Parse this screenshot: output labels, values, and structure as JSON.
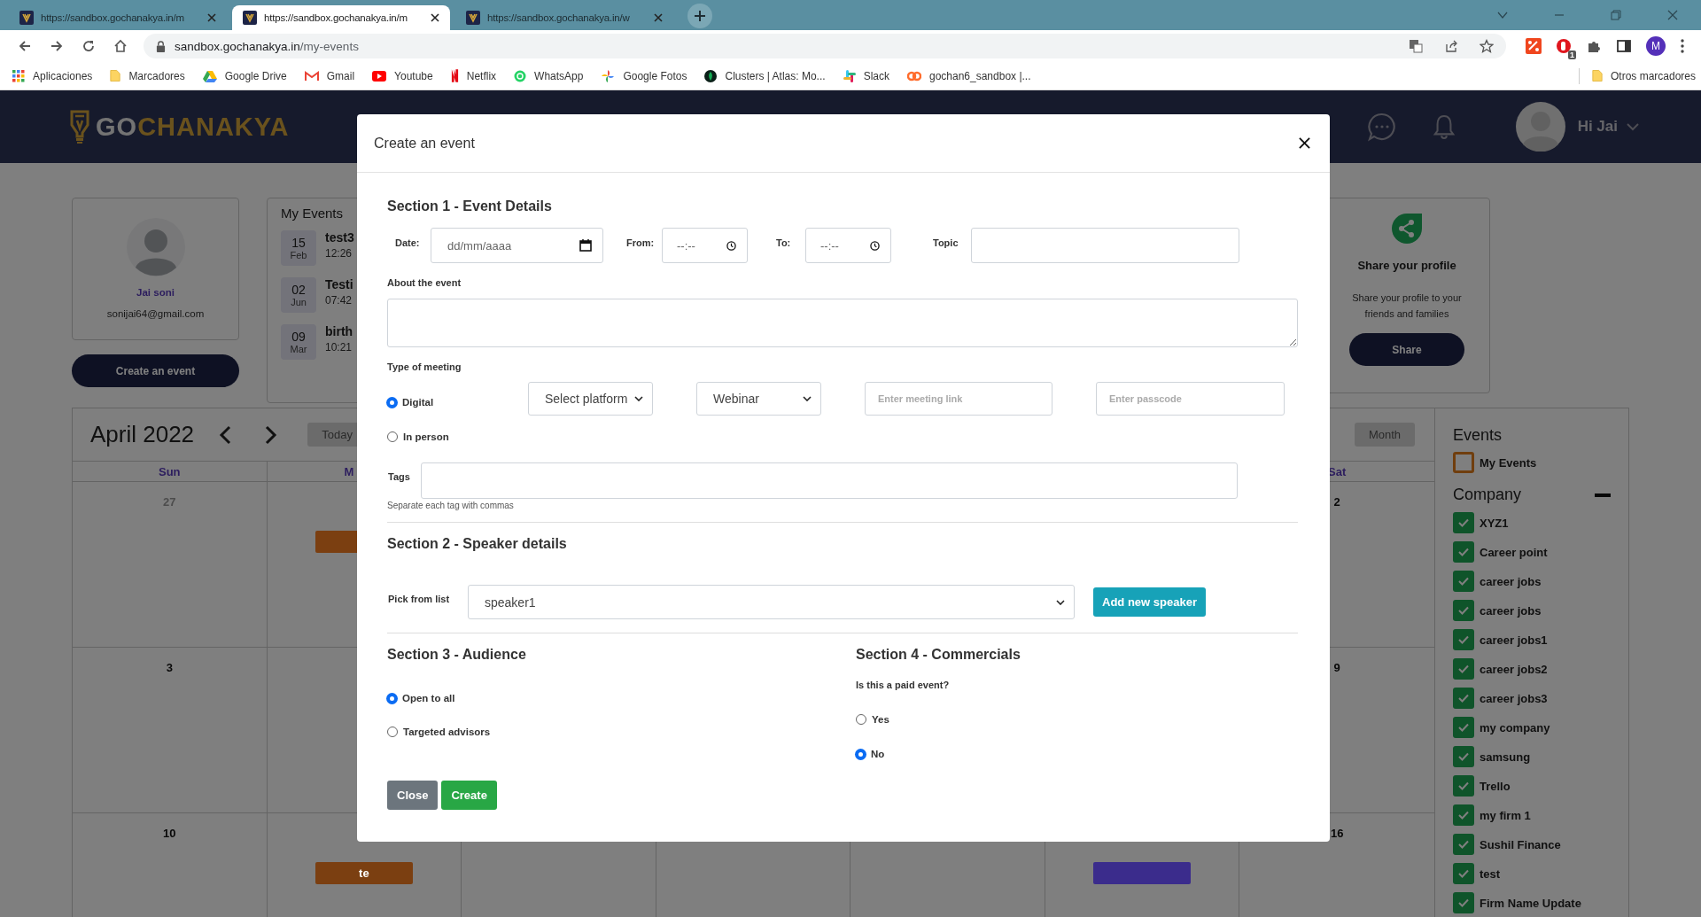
{
  "browser": {
    "tabs": [
      {
        "title": "https://sandbox.gochanakya.in/m",
        "selected": false
      },
      {
        "title": "https://sandbox.gochanakya.in/m",
        "selected": true
      },
      {
        "title": "https://sandbox.gochanakya.in/w",
        "selected": false
      }
    ],
    "address": {
      "host": "sandbox.gochanakya.in",
      "path": "/my-events"
    },
    "extension_badge": "1",
    "profile_initial": "M",
    "bookmarks": [
      {
        "label": "Aplicaciones",
        "kind": "apps"
      },
      {
        "label": "Marcadores",
        "kind": "folder"
      },
      {
        "label": "Google Drive",
        "kind": "drive"
      },
      {
        "label": "Gmail",
        "kind": "gmail"
      },
      {
        "label": "Youtube",
        "kind": "youtube"
      },
      {
        "label": "Netflix",
        "kind": "netflix"
      },
      {
        "label": "WhatsApp",
        "kind": "whatsapp"
      },
      {
        "label": "Google Fotos",
        "kind": "photos"
      },
      {
        "label": "Clusters | Atlas: Mo...",
        "kind": "leaf"
      },
      {
        "label": "Slack",
        "kind": "slack"
      },
      {
        "label": "gochan6_sandbox |...",
        "kind": "cpanel"
      }
    ],
    "other_bookmarks": "Otros marcadores"
  },
  "header": {
    "logo_first": "GO",
    "logo_second": "CHANAKYA",
    "greeting": "Hi Jai"
  },
  "profile": {
    "name": "Jai soni",
    "email": "sonijai64@gmail.com",
    "button": "Create an event"
  },
  "my_events": {
    "title": "My Events",
    "items": [
      {
        "day": "15",
        "month": "Feb",
        "title": "test3",
        "time": "12:26"
      },
      {
        "day": "02",
        "month": "Jun",
        "title": "Testi",
        "time": "07:42"
      },
      {
        "day": "09",
        "month": "Mar",
        "title": "birth",
        "time": "10:21"
      }
    ]
  },
  "share": {
    "title": "Share your profile",
    "text": "Share your profile to your friends and families",
    "button": "Share"
  },
  "calendar": {
    "title": "April 2022",
    "today_button": "Today",
    "month_button": "Month",
    "weekdays": {
      "sun": "Sun",
      "mon": "M",
      "sat": "Sat"
    },
    "weeks": [
      {
        "sun": {
          "label": "27",
          "other_month": true
        },
        "sat": {
          "label": "2",
          "other_month": false
        },
        "events": {
          "mon": [
            {
              "color": "#7b3f11"
            }
          ]
        }
      },
      {
        "sun": {
          "label": "3",
          "other_month": false
        },
        "sat": {
          "label": "9",
          "other_month": false
        }
      },
      {
        "sun": {
          "label": "10",
          "other_month": false
        },
        "sat": {
          "label": "16",
          "other_month": false
        },
        "events": {
          "mon": [
            {
              "label": "te",
              "color": "#7b3f11"
            }
          ],
          "fri": [
            {
              "color": "#3b2c8c"
            }
          ]
        }
      }
    ]
  },
  "sidebar": {
    "title": "Events",
    "my_events": {
      "label": "My Events",
      "checked": false
    },
    "company_title": "Company",
    "company_expanded": true,
    "companies": [
      {
        "label": "XYZ1",
        "checked": true
      },
      {
        "label": "Career point",
        "checked": true
      },
      {
        "label": "career jobs",
        "checked": true
      },
      {
        "label": "career jobs",
        "checked": true
      },
      {
        "label": "career jobs1",
        "checked": true
      },
      {
        "label": "career jobs2",
        "checked": true
      },
      {
        "label": "career jobs3",
        "checked": true
      },
      {
        "label": "my company",
        "checked": true
      },
      {
        "label": "samsung",
        "checked": true
      },
      {
        "label": "Trello",
        "checked": true
      },
      {
        "label": "my firm 1",
        "checked": true
      },
      {
        "label": "Sushil Finance",
        "checked": true
      },
      {
        "label": "test",
        "checked": true
      },
      {
        "label": "Firm Name Update",
        "checked": true
      }
    ]
  },
  "modal": {
    "title": "Create an event",
    "section1": {
      "title": "Section 1 - Event Details",
      "date_label": "Date:",
      "date_placeholder": "dd/mm/aaaa",
      "from_label": "From:",
      "from_placeholder": "--:--",
      "to_label": "To:",
      "to_placeholder": "--:--",
      "topic_label": "Topic",
      "about_label": "About the event",
      "meeting_label": "Type of meeting",
      "meeting_types": [
        {
          "label": "Digital",
          "selected": true
        },
        {
          "label": "In person",
          "selected": false
        }
      ],
      "platform_select": "Select platform",
      "format_select": "Webinar",
      "link_placeholder": "Enter meeting link",
      "passcode_placeholder": "Enter passcode",
      "tags_label": "Tags",
      "tags_help": "Separate each tag with commas"
    },
    "section2": {
      "title": "Section 2 - Speaker details",
      "pick_label": "Pick from list",
      "speaker": "speaker1",
      "add_button": "Add new speaker"
    },
    "section3": {
      "title": "Section 3 - Audience",
      "options": [
        {
          "label": "Open to all",
          "selected": true
        },
        {
          "label": "Targeted advisors",
          "selected": false
        }
      ]
    },
    "section4": {
      "title": "Section 4 - Commercials",
      "question": "Is this a paid event?",
      "options": [
        {
          "label": "Yes",
          "selected": false
        },
        {
          "label": "No",
          "selected": true
        }
      ]
    },
    "buttons": [
      {
        "label": "Close",
        "kind": "secondary"
      },
      {
        "label": "Create",
        "kind": "primary"
      }
    ]
  }
}
